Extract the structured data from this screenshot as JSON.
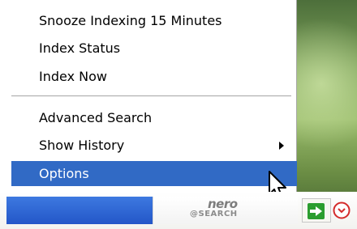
{
  "menu": {
    "items": [
      {
        "label": "Snooze Indexing 15 Minutes",
        "selected": false,
        "has_submenu": false
      },
      {
        "label": "Index Status",
        "selected": false,
        "has_submenu": false
      },
      {
        "label": "Index Now",
        "selected": false,
        "has_submenu": false
      },
      {
        "label": "Advanced Search",
        "selected": false,
        "has_submenu": false
      },
      {
        "label": "Show History",
        "selected": false,
        "has_submenu": true
      },
      {
        "label": "Options",
        "selected": true,
        "has_submenu": false
      }
    ]
  },
  "taskbar": {
    "brand_top": "nero",
    "brand_bottom": "@SEARCH"
  },
  "icons": {
    "submenu_arrow": "chevron-right-icon",
    "cursor": "mouse-pointer-icon",
    "tray_green": "go-arrow-icon",
    "tray_red": "dropdown-circle-icon"
  },
  "colors": {
    "selection": "#316ac5",
    "menu_bg": "#ffffff",
    "taskbar_blue": "#2356c8",
    "green": "#2b9d2f",
    "red": "#d42b2b"
  }
}
